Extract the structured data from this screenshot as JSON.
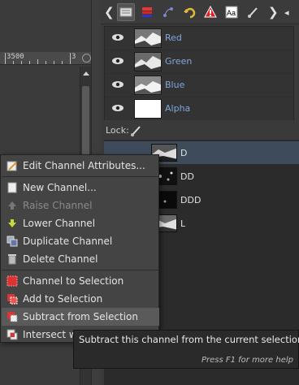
{
  "tabs": {
    "items": [
      "channels-tab",
      "layers-tab",
      "paths-tab",
      "undo-tab",
      "warning-tab",
      "fonts-tab",
      "brush-tab"
    ]
  },
  "ruler": {
    "mark1": "3500",
    "mark2": "3"
  },
  "channels": [
    {
      "label": "Red"
    },
    {
      "label": "Green"
    },
    {
      "label": "Blue"
    },
    {
      "label": "Alpha"
    }
  ],
  "lock": {
    "label": "Lock:"
  },
  "layers": [
    {
      "label": "D",
      "selected": true
    },
    {
      "label": "DD",
      "selected": false
    },
    {
      "label": "DDD",
      "selected": false
    },
    {
      "label": "L",
      "selected": false
    }
  ],
  "menu": {
    "items": [
      {
        "label": "Edit Channel Attributes...",
        "icon": "edit-icon",
        "disabled": false
      },
      {
        "label": "New Channel...",
        "icon": "new-channel-icon",
        "disabled": false
      },
      {
        "label": "Raise Channel",
        "icon": "raise-icon",
        "disabled": true
      },
      {
        "label": "Lower Channel",
        "icon": "lower-icon",
        "disabled": false
      },
      {
        "label": "Duplicate Channel",
        "icon": "duplicate-icon",
        "disabled": false
      },
      {
        "label": "Delete Channel",
        "icon": "delete-icon",
        "disabled": false
      },
      {
        "label": "Channel to Selection",
        "icon": "channel-to-selection-icon",
        "disabled": false
      },
      {
        "label": "Add to Selection",
        "icon": "add-selection-icon",
        "disabled": false
      },
      {
        "label": "Subtract from Selection",
        "icon": "subtract-selection-icon",
        "disabled": false
      },
      {
        "label": "Intersect w",
        "icon": "intersect-selection-icon",
        "disabled": false
      }
    ]
  },
  "tooltip": {
    "text": "Subtract this channel from the current selection",
    "help": "Press F1 for more help"
  },
  "colors": {
    "accent_label": "#7fa7dc",
    "selected_row": "#3d4b5b",
    "menu_bg": "#444444"
  }
}
